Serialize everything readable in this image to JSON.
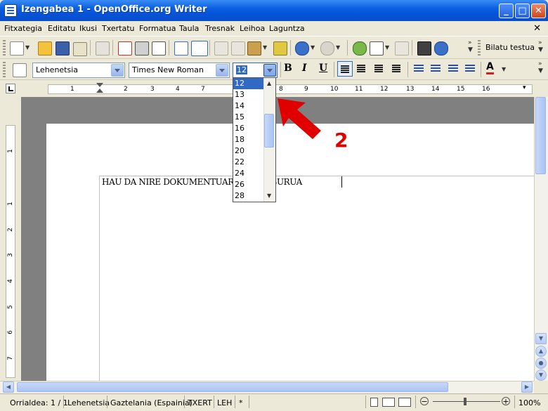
{
  "window": {
    "title": "Izengabea 1 - OpenOffice.org Writer",
    "minimize": "_",
    "maximize": "□",
    "close": "✕"
  },
  "menu": [
    {
      "label": "Fitxategia"
    },
    {
      "label": "Editatu"
    },
    {
      "label": "Ikusi"
    },
    {
      "label": "Txertatu"
    },
    {
      "label": "Formatua"
    },
    {
      "label": "Taula"
    },
    {
      "label": "Tresnak"
    },
    {
      "label": "Leihoa"
    },
    {
      "label": "Laguntza"
    }
  ],
  "menu_close": "✕",
  "toolbar1": {
    "find_label": "Bilatu testua",
    "icons": [
      "new-document-icon",
      "open-folder-icon",
      "save-icon",
      "email-icon",
      "edit-icon",
      "pdf-export-icon",
      "print-icon",
      "print-preview-icon",
      "spellcheck-icon",
      "autocheck-icon",
      "cut-icon",
      "copy-icon",
      "paste-icon",
      "format-paintbrush-icon",
      "undo-icon",
      "redo-icon",
      "gallery-icon",
      "table-icon",
      "draw-icon",
      "binoculars-icon",
      "navigator-icon"
    ]
  },
  "toolbar2": {
    "style_value": "Lehenetsia",
    "font_value": "Times New Roman",
    "size_value": "12",
    "bold": "B",
    "italic": "I",
    "underline": "U"
  },
  "ruler_numbers": [
    "1",
    "2",
    "3",
    "4",
    "7",
    "8",
    "9",
    "10",
    "11",
    "12",
    "13",
    "14",
    "15",
    "16"
  ],
  "vruler_numbers": [
    "1",
    "1",
    "2",
    "3",
    "4",
    "5",
    "6",
    "7"
  ],
  "document": {
    "text": "HAU DA NIRE DOKUMENTUAREN IZENBURUA"
  },
  "size_dropdown": {
    "options": [
      "12",
      "13",
      "14",
      "15",
      "16",
      "18",
      "20",
      "22",
      "24",
      "26",
      "28"
    ],
    "selected": "12"
  },
  "annotation": {
    "number": "2",
    "arrow_color": "#e00000"
  },
  "statusbar": {
    "page": "Orrialdea: 1 / 1",
    "style": "Lehenetsia",
    "language": "Gaztelania (Espainia)",
    "insert_mode": "TXERT",
    "selection_mode": "LEH",
    "modified": "*",
    "zoom": "100%"
  },
  "colors": {
    "titlebar": "#0a5fe0",
    "selection": "#316ac5",
    "workspace": "#808080"
  }
}
